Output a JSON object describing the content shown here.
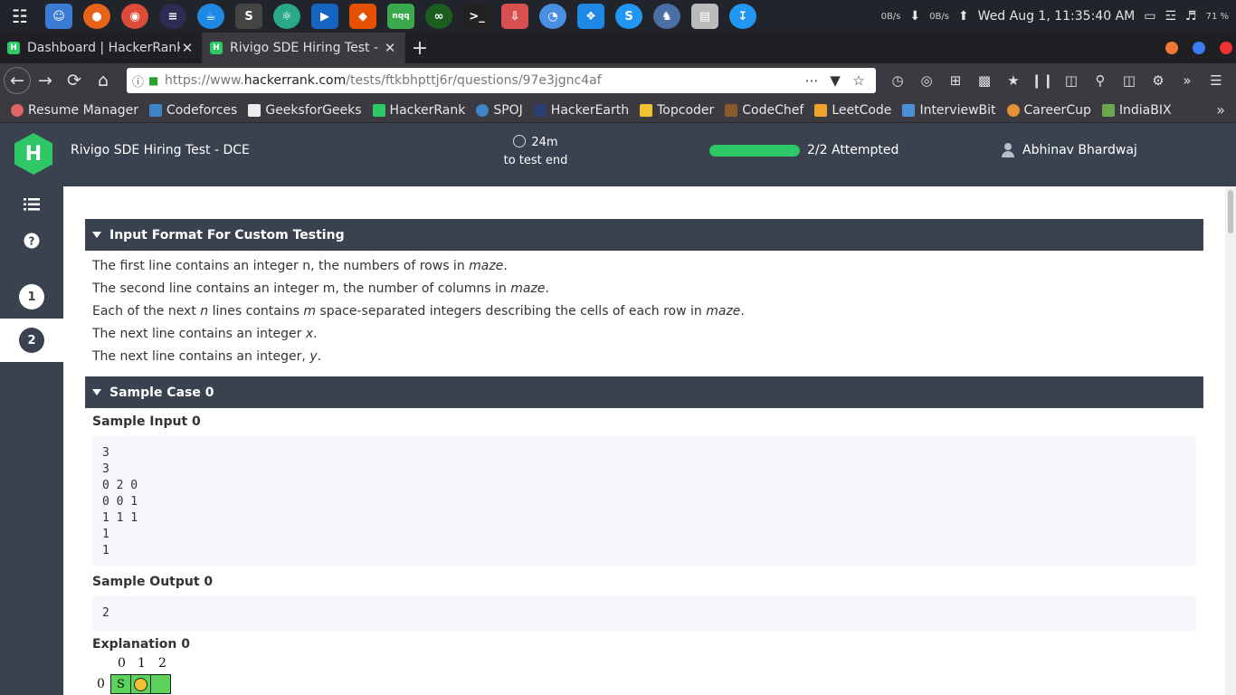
{
  "os": {
    "net_down": "0B/s",
    "net_up": "0B/s",
    "datetime": "Wed Aug  1, 11:35:40 AM",
    "battery": "71 %"
  },
  "tabs": [
    {
      "title": "Dashboard | HackerRank",
      "active": false
    },
    {
      "title": "Rivigo SDE Hiring Test - DCE",
      "active": true
    }
  ],
  "address": {
    "prefix": "https://www.",
    "domain": "hackerrank.com",
    "path": "/tests/ftkbhpttj6r/questions/97e3jgnc4af"
  },
  "bookmarks": [
    {
      "label": "Resume Manager",
      "color": "#e06666"
    },
    {
      "label": "Codeforces",
      "color": "#3d85c6"
    },
    {
      "label": "GeeksforGeeks",
      "color": "#eeeeee"
    },
    {
      "label": "HackerRank",
      "color": "#2ec866"
    },
    {
      "label": "SPOJ",
      "color": "#3d85c6"
    },
    {
      "label": "HackerEarth",
      "color": "#2c3e70"
    },
    {
      "label": "Topcoder",
      "color": "#f1c232"
    },
    {
      "label": "CodeChef",
      "color": "#8b5a2b"
    },
    {
      "label": "LeetCode",
      "color": "#f0a32c"
    },
    {
      "label": "InterviewBit",
      "color": "#4a90d9"
    },
    {
      "label": "CareerCup",
      "color": "#e69138"
    },
    {
      "label": "IndiaBIX",
      "color": "#6aa84f"
    }
  ],
  "header": {
    "logo_letter": "H",
    "test_name": "Rivigo SDE Hiring Test - DCE",
    "timer_value": "24m",
    "timer_label": "to test end",
    "progress_fraction": 1.0,
    "attempted": "2/2 Attempted",
    "user": "Abhinav Bhardwaj"
  },
  "rail": {
    "questions": [
      "1",
      "2"
    ],
    "selected": "2"
  },
  "content": {
    "input_section_title": "Input Format For Custom Testing",
    "input_lines": [
      {
        "pre": "The first line contains an integer n, the numbers of rows in ",
        "em": "maze",
        "post": "."
      },
      {
        "pre": "The second line contains an integer m, the number of columns in ",
        "em": "maze",
        "post": "."
      },
      {
        "pre": "Each of the next ",
        "em": "n",
        "post": " lines contains ",
        "em2": "m",
        "post2": " space-separated integers describing the cells of each row in ",
        "em3": "maze",
        "post3": "."
      },
      {
        "pre": "The next line contains an integer ",
        "em": "x",
        "post": "."
      },
      {
        "pre": "The next line contains an integer, ",
        "em": "y",
        "post": "."
      }
    ],
    "sample_section_title": "Sample Case 0",
    "sample_input_label": "Sample Input 0",
    "sample_input": "3\n3\n0 2 0\n0 0 1\n1 1 1\n1\n1",
    "sample_output_label": "Sample Output 0",
    "sample_output": "2",
    "explanation_label": "Explanation 0",
    "maze_cols": [
      "0",
      "1",
      "2"
    ],
    "maze_row_label": "0",
    "maze_start_label": "S"
  }
}
